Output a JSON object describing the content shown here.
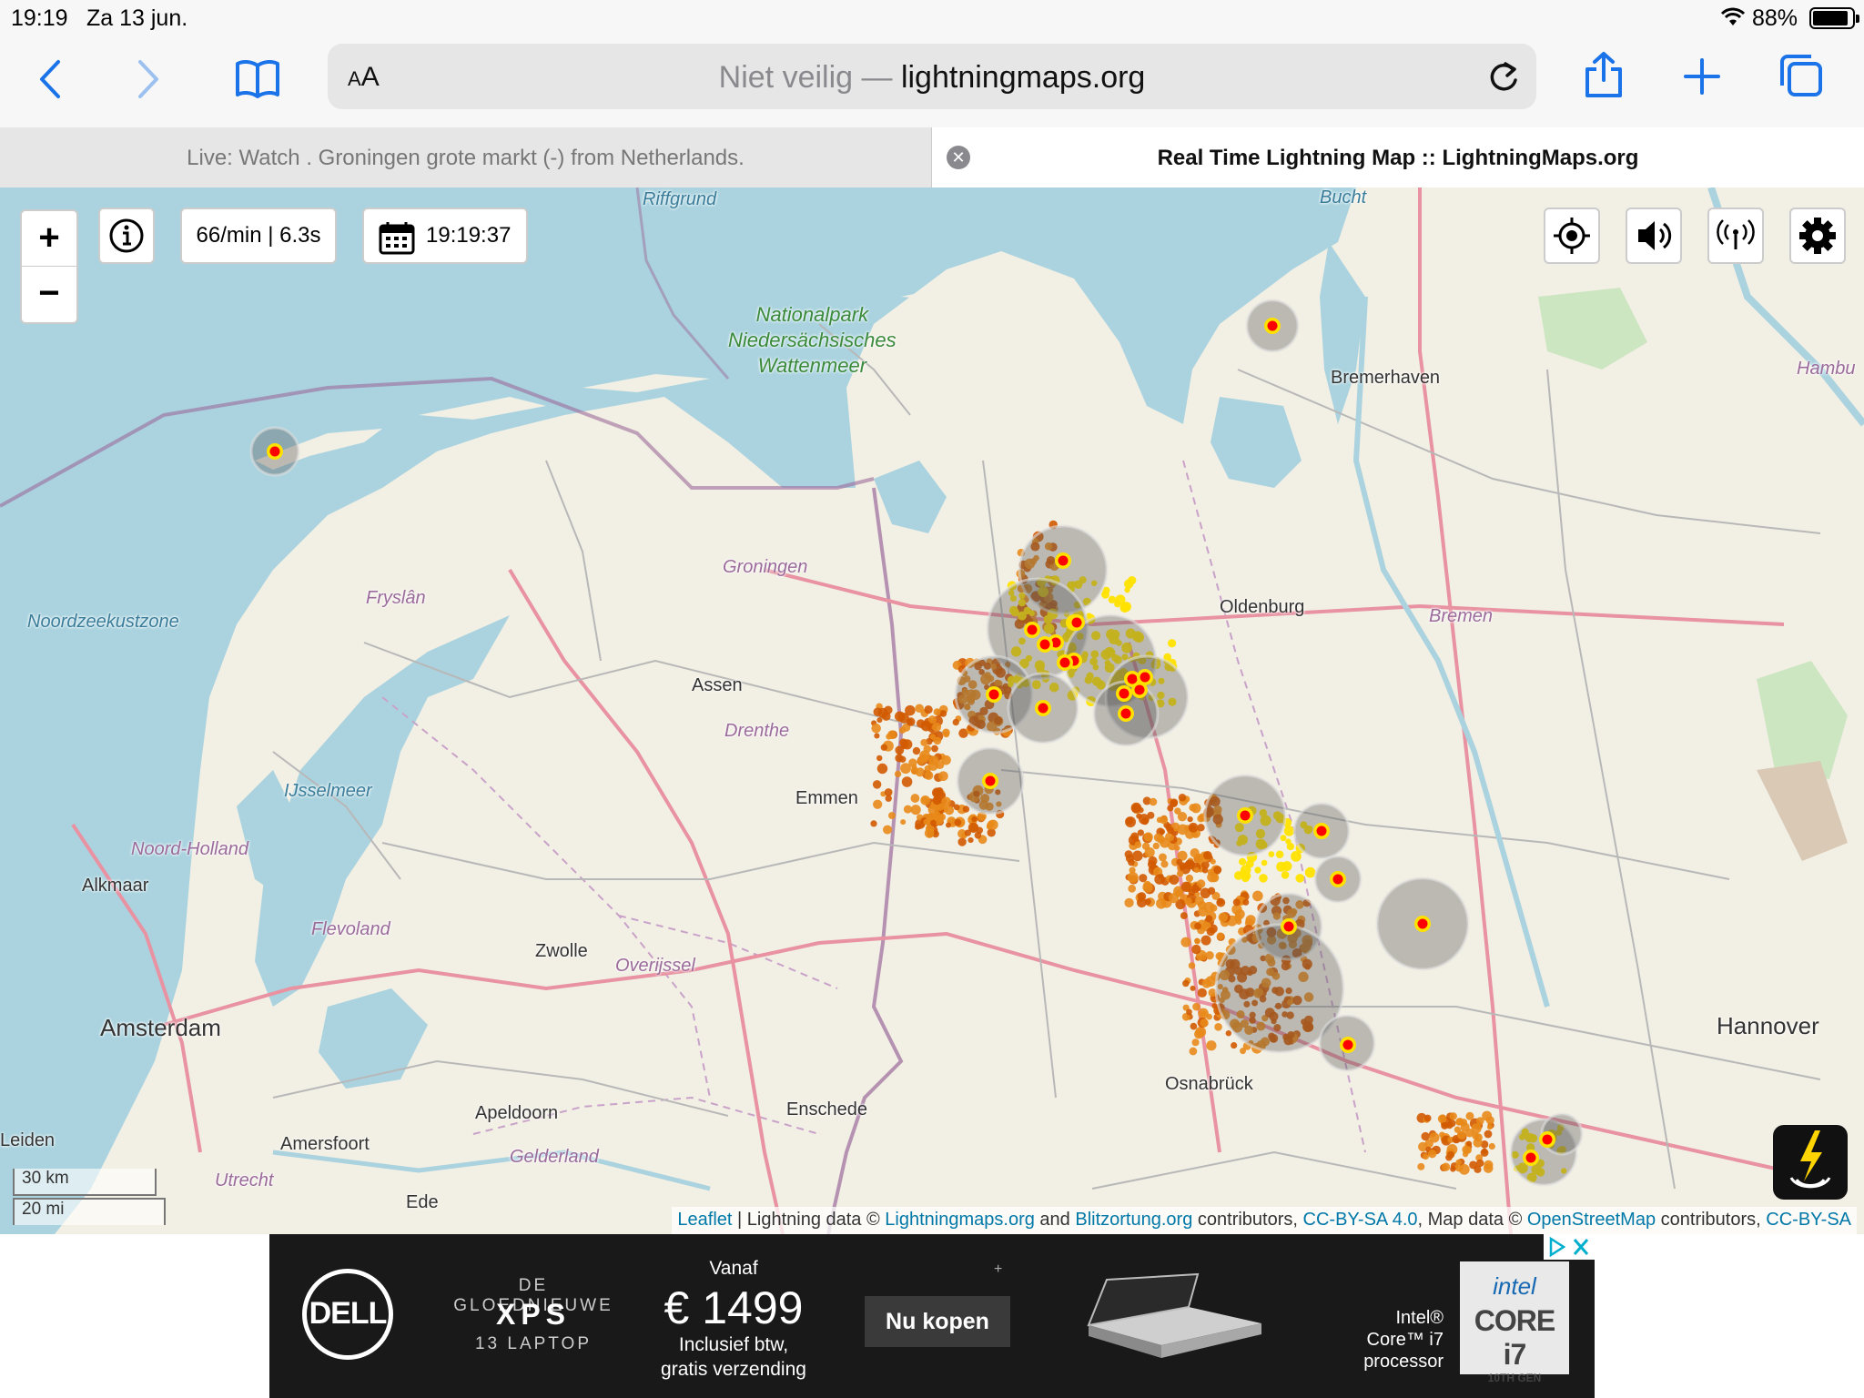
{
  "status_bar": {
    "time": "19:19",
    "date": "Za 13 jun.",
    "battery": "88%"
  },
  "toolbar": {
    "text_size_label": "AA",
    "url_prefix": "Niet veilig —",
    "url_domain": "lightningmaps.org"
  },
  "tabs": [
    {
      "title": "Live: Watch . Groningen grote markt (-) from Netherlands."
    },
    {
      "title": "Real Time Lightning Map :: LightningMaps.org"
    }
  ],
  "map": {
    "zoom_in": "+",
    "zoom_out": "−",
    "rate": "66/min | 6.3s",
    "clock": "19:19:37",
    "labels": {
      "riffgrund": "Riffgrund",
      "bucht": "Bucht",
      "park_1": "Nationalpark",
      "park_2": "Niedersächsisches",
      "park_3": "Wattenmeer",
      "bremerhaven": "Bremerhaven",
      "hamburg": "Hambu",
      "groningen": "Groningen",
      "fryslan": "Fryslân",
      "noordzeekustzone": "Noordzeekustzone",
      "oldenburg": "Oldenburg",
      "bremen": "Bremen",
      "assen": "Assen",
      "drenthe": "Drenthe",
      "ijsselmeer": "IJsselmeer",
      "emmen": "Emmen",
      "noord_holland": "Noord-Holland",
      "alkmaar": "Alkmaar",
      "flevoland": "Flevoland",
      "zwolle": "Zwolle",
      "overijssel": "Overijssel",
      "amsterdam": "Amsterdam",
      "hannover": "Hannover",
      "osnabruck": "Osnabrück",
      "apeldoorn": "Apeldoorn",
      "enschede": "Enschede",
      "leiden": "Leiden",
      "amersfoort": "Amersfoort",
      "gelderland": "Gelderland",
      "utrecht": "Utrecht",
      "ede": "Ede"
    },
    "scale_km": "30 km",
    "scale_mi": "20 mi",
    "attribution": {
      "leaflet": "Leaflet",
      "sep": "| Lightning data ©",
      "lm": "Lightningmaps.org",
      "and": "and",
      "bo": "Blitzortung.org",
      "contrib": "contributors,",
      "cc1": "CC-BY-SA 4.0",
      "mapdata": ", Map data ©",
      "osm": "OpenStreetMap",
      "contrib2": "contributors,",
      "cc2": "CC-BY-SA"
    },
    "colors": {
      "water": "#aad3df",
      "land": "#f2efe4",
      "strike_new": "#ff0000",
      "strike_recent": "#ffe100",
      "strike_old": "#d25a00"
    }
  },
  "ad": {
    "brand": "DELL",
    "line1": "DE GLOEDNIEUWE",
    "line2": "XPS",
    "line3": "13 LAPTOP",
    "vanaf": "Vanaf",
    "price": "€ 1499",
    "incl_1": "Inclusief btw,",
    "incl_2": "gratis verzending",
    "cta": "Nu kopen",
    "proc_1": "Intel®",
    "proc_2": "Core™ i7",
    "proc_3": "processor",
    "chip_brand": "intel",
    "chip_model": "CORE i7",
    "chip_gen": "10TH GEN"
  }
}
